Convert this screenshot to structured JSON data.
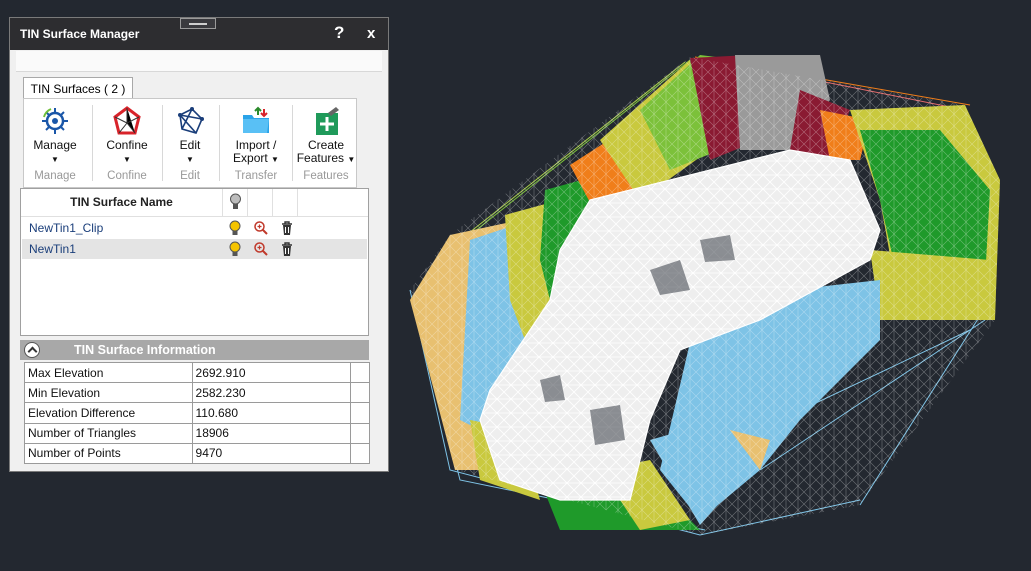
{
  "panel": {
    "title": "TIN Surface Manager",
    "help_label": "?",
    "close_label": "x"
  },
  "tab": {
    "label": "TIN Surfaces ( 2 )"
  },
  "ribbon": {
    "groups": [
      {
        "label": "Manage",
        "group": "Manage",
        "icon": "gear-cycle-icon"
      },
      {
        "label": "Confine",
        "group": "Confine",
        "icon": "confine-polygon-icon"
      },
      {
        "label": "Edit",
        "group": "Edit",
        "icon": "edit-mesh-icon"
      },
      {
        "label_1": "Import /",
        "label_2": "Export",
        "group": "Transfer",
        "icon": "folder-transfer-icon"
      },
      {
        "label_1": "Create",
        "label_2": "Features",
        "group": "Features",
        "icon": "create-features-icon"
      }
    ]
  },
  "list": {
    "header": "TIN Surface Name",
    "rows": [
      {
        "name": "NewTin1_Clip"
      },
      {
        "name": "NewTin1"
      }
    ]
  },
  "info": {
    "title": "TIN Surface Information",
    "rows": [
      {
        "key": "Max Elevation",
        "value": "2692.910"
      },
      {
        "key": "Min Elevation",
        "value": "2582.230"
      },
      {
        "key": "Elevation Difference",
        "value": "110.680"
      },
      {
        "key": "Number of Triangles",
        "value": "18906"
      },
      {
        "key": "Number of Points",
        "value": "9470"
      }
    ]
  },
  "colors": {
    "viewport_bg": "#232830",
    "tin_white": "#ffffff",
    "tin_blue": "#7ec3e6",
    "tin_yellow": "#c9c93e",
    "tin_green": "#1f9a2a",
    "tin_orange": "#f07e1a",
    "tin_maroon": "#8a1a32",
    "tin_gray": "#9a9a9a"
  }
}
